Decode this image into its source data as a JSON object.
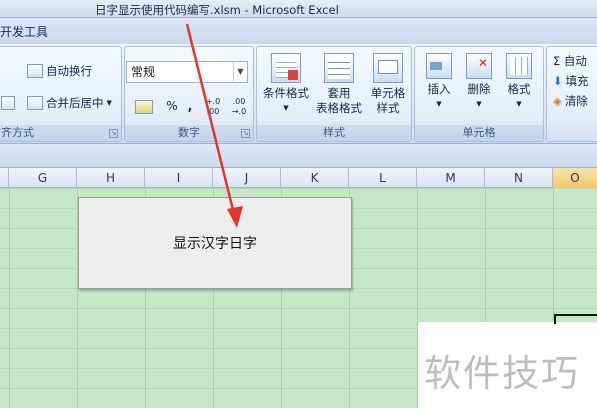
{
  "window": {
    "title": "日字显示使用代码编写.xlsm - Microsoft Excel"
  },
  "ribbon": {
    "active_tab": "开发工具",
    "alignment_group": {
      "wrap_text": "自动换行",
      "merge_center": "合并后居中",
      "label": "齐方式"
    },
    "number_group": {
      "format_value": "常规",
      "percent": "%",
      "comma": ",",
      "inc_decimal": "+.0 .00",
      "dec_decimal": ".00 →.0",
      "label": "数字"
    },
    "styles_group": {
      "conditional_format": "条件格式",
      "table_format_line1": "套用",
      "table_format_line2": "表格格式",
      "cell_styles_line1": "单元格",
      "cell_styles_line2": "样式",
      "label": "样式"
    },
    "cells_group": {
      "insert": "插入",
      "delete": "删除",
      "format": "格式",
      "label": "单元格"
    },
    "editing_group": {
      "autosum": "Σ 自动",
      "fill": "填充",
      "clear": "清除"
    }
  },
  "sheet": {
    "columns": [
      "G",
      "H",
      "I",
      "J",
      "K",
      "L",
      "M",
      "N",
      "O"
    ],
    "active_column": "O",
    "button_label": "显示汉字日字"
  },
  "watermark": "软件技巧"
}
